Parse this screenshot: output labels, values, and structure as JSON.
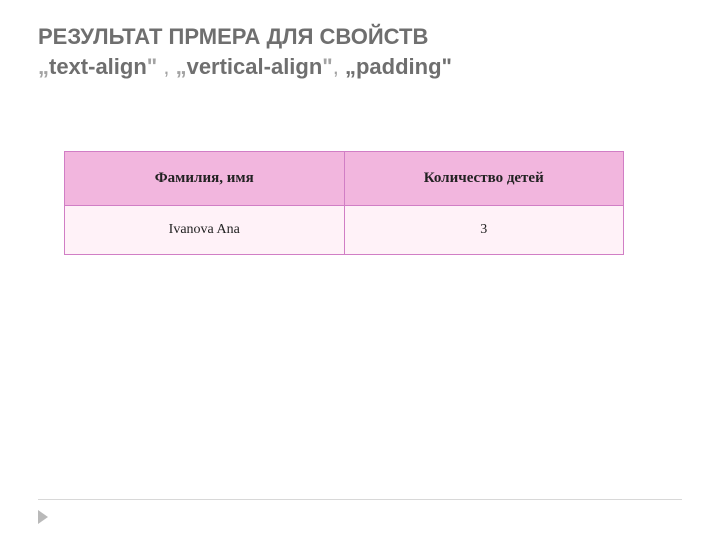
{
  "heading": {
    "line1": "РЕЗУЛЬТАТ ПРМЕРА ДЛЯ СВОЙСТВ",
    "q_open": "„",
    "q_close": "\"",
    "prop1": "text-align",
    "sep1": " , ",
    "prop2": "vertical-align",
    "sep2": ", ",
    "prop3_with_quotes": "„padding\""
  },
  "table": {
    "headers": [
      "Фамилия, имя",
      "Количество детей"
    ],
    "rows": [
      [
        "Ivanova Ana",
        "3"
      ]
    ]
  }
}
